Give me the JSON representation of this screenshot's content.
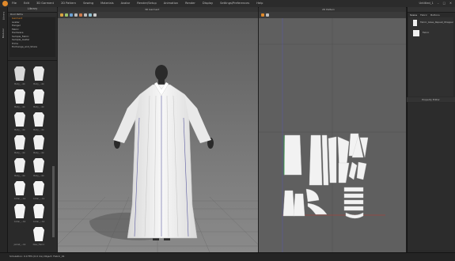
{
  "app": {
    "menus": [
      "File",
      "Edit",
      "3D Garment",
      "2D Pattern",
      "Sewing",
      "Materials",
      "Avatar",
      "Render/Setup",
      "Animation",
      "Render",
      "Display",
      "Settings/Preferences",
      "Help"
    ],
    "window_title": "Untitled_1"
  },
  "left_strip": {
    "tabs": [
      "Library",
      "Modular"
    ]
  },
  "library": {
    "header": "Library",
    "tree_title": "Root Paths",
    "tree_items": [
      "Garment",
      "Avatar",
      "Hanger",
      "Fabric",
      "Hardware",
      "Sample_Fabric",
      "Sample_Avatar",
      "Trims",
      "Exchange_and_Share"
    ],
    "items": [
      {
        "label": "Body_...bk",
        "thumb": "#d8d8d8"
      },
      {
        "label": "Body_...bk",
        "thumb": "#e8e8e8"
      },
      {
        "label": "Body_...bk",
        "thumb": "#f0f0f0"
      },
      {
        "label": "Body_...bk",
        "thumb": "#f0f0f0"
      },
      {
        "label": "Body_...bk",
        "thumb": "#f0f0f0"
      },
      {
        "label": "Body_...bk",
        "thumb": "#f0f0f0"
      },
      {
        "label": "Body_...bk",
        "thumb": "#f0f0f0"
      },
      {
        "label": "Body_...bk",
        "thumb": "#f0f0f0"
      },
      {
        "label": "Body_...bk",
        "thumb": "#f0f0f0"
      },
      {
        "label": "Body_...bk",
        "thumb": "#f0f0f0"
      },
      {
        "label": "Collar_...bk",
        "thumb": "#f4f4f4"
      },
      {
        "label": "Collar_...bk",
        "thumb": "#f4f4f4"
      },
      {
        "label": "Collar_...bk",
        "thumb": "#f4f4f4"
      },
      {
        "label": "Collar_...bk",
        "thumb": "#f4f4f4"
      },
      {
        "label": "Jacket_...bk",
        "thumb": "#2a2a2a"
      },
      {
        "label": "New_Fabric",
        "thumb": "#f4f4f4"
      }
    ]
  },
  "viewport3d": {
    "header": "3D Garment"
  },
  "viewport2d": {
    "header": "2D Pattern"
  },
  "object_browser": {
    "tabs": [
      "Scene",
      "Fabric",
      "Buttons"
    ],
    "items": [
      {
        "label": "Fabric_Glass_Repeat_Wrapper",
        "swatch": "#f2f2f2"
      },
      {
        "label": "Fabric",
        "swatch": "#f2f2f2"
      }
    ]
  },
  "property_editor": {
    "header": "Property Editor"
  },
  "status": {
    "text": "Simulation: 0.0 FPS (0.0 ms)  Object: Fabric_01"
  },
  "colors": {
    "accent": "#e0892a",
    "stitch_green": "#2fa34a",
    "baseline_red": "#c0392b",
    "avatar_line": "#5a5aa0"
  }
}
